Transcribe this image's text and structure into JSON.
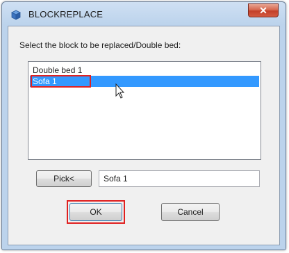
{
  "window": {
    "title": "BLOCKREPLACE",
    "close_glyph": "✕"
  },
  "prompt": "Select the block to be replaced/Double bed:",
  "block_list": {
    "items": [
      {
        "label": "Double bed 1",
        "selected": false
      },
      {
        "label": "Sofa 1",
        "selected": true
      }
    ]
  },
  "pick_button": {
    "label": "Pick<"
  },
  "block_name_field": {
    "value": "Sofa 1"
  },
  "buttons": {
    "ok_label": "OK",
    "cancel_label": "Cancel"
  },
  "icons": {
    "app": "block-app-icon",
    "cursor": "mouse-pointer-icon"
  },
  "colors": {
    "selection": "#3399ff",
    "highlight_mark": "#e02020",
    "close_button": "#c3402a"
  }
}
